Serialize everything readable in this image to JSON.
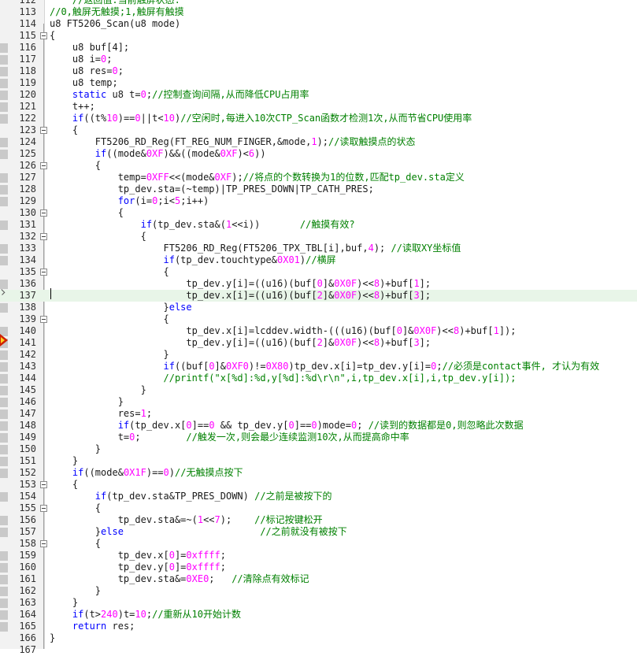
{
  "colors": {
    "keyword": "#0000ff",
    "number": "#ff00ff",
    "comment": "#008000",
    "text": "#1a1a1a",
    "current_line": "#e8f5e8",
    "breakpoint": "#d02000"
  },
  "editor": {
    "current_line": 137,
    "execution_marker_line": 141,
    "lines": [
      {
        "n": "112",
        "fold": false,
        "tokens": [
          {
            "t": "    "
          },
          {
            "t": "//返回值:当前触屏状态.",
            "c": "cm"
          }
        ]
      },
      {
        "n": "113",
        "fold": false,
        "tokens": [
          {
            "t": "//0,触屏无触摸;1,触屏有触摸",
            "c": "cm"
          }
        ]
      },
      {
        "n": "114",
        "fold": false,
        "tokens": [
          {
            "t": "u8 FT5206_Scan(u8 mode)"
          }
        ]
      },
      {
        "n": "115",
        "fold": true,
        "tokens": [
          {
            "t": "{"
          }
        ]
      },
      {
        "n": "116",
        "fold": false,
        "tokens": [
          {
            "t": "    u8 buf[4];"
          }
        ]
      },
      {
        "n": "117",
        "fold": false,
        "tokens": [
          {
            "t": "    u8 i="
          },
          {
            "t": "0",
            "c": "num"
          },
          {
            "t": ";"
          }
        ]
      },
      {
        "n": "118",
        "fold": false,
        "tokens": [
          {
            "t": "    u8 res="
          },
          {
            "t": "0",
            "c": "num"
          },
          {
            "t": ";"
          }
        ]
      },
      {
        "n": "119",
        "fold": false,
        "tokens": [
          {
            "t": "    u8 temp;"
          }
        ]
      },
      {
        "n": "120",
        "fold": false,
        "tokens": [
          {
            "t": "    "
          },
          {
            "t": "static",
            "c": "kw"
          },
          {
            "t": " u8 t="
          },
          {
            "t": "0",
            "c": "num"
          },
          {
            "t": ";"
          },
          {
            "t": "//控制查询间隔,从而降低CPU占用率",
            "c": "cm"
          }
        ]
      },
      {
        "n": "121",
        "fold": false,
        "tokens": [
          {
            "t": "    t++;"
          }
        ]
      },
      {
        "n": "122",
        "fold": false,
        "tokens": [
          {
            "t": "    "
          },
          {
            "t": "if",
            "c": "kw"
          },
          {
            "t": "((t%"
          },
          {
            "t": "10",
            "c": "num"
          },
          {
            "t": ")=="
          },
          {
            "t": "0",
            "c": "num"
          },
          {
            "t": "||t<"
          },
          {
            "t": "10",
            "c": "num"
          },
          {
            "t": ")"
          },
          {
            "t": "//空闲时,每进入10次CTP_Scan函数才检测1次,从而节省CPU使用率",
            "c": "cm"
          }
        ]
      },
      {
        "n": "123",
        "fold": true,
        "tokens": [
          {
            "t": "    {"
          }
        ]
      },
      {
        "n": "124",
        "fold": false,
        "tokens": [
          {
            "t": "        FT5206_RD_Reg(FT_REG_NUM_FINGER,&mode,"
          },
          {
            "t": "1",
            "c": "num"
          },
          {
            "t": ");"
          },
          {
            "t": "//读取触摸点的状态",
            "c": "cm"
          }
        ]
      },
      {
        "n": "125",
        "fold": false,
        "tokens": [
          {
            "t": "        "
          },
          {
            "t": "if",
            "c": "kw"
          },
          {
            "t": "((mode&"
          },
          {
            "t": "0XF",
            "c": "num"
          },
          {
            "t": ")&&((mode&"
          },
          {
            "t": "0XF",
            "c": "num"
          },
          {
            "t": ")<"
          },
          {
            "t": "6",
            "c": "num"
          },
          {
            "t": "))"
          }
        ]
      },
      {
        "n": "126",
        "fold": true,
        "tokens": [
          {
            "t": "        {"
          }
        ]
      },
      {
        "n": "127",
        "fold": false,
        "tokens": [
          {
            "t": "            temp="
          },
          {
            "t": "0XFF",
            "c": "num"
          },
          {
            "t": "<<(mode&"
          },
          {
            "t": "0XF",
            "c": "num"
          },
          {
            "t": ");"
          },
          {
            "t": "//将点的个数转换为1的位数,匹配tp_dev.sta定义",
            "c": "cm"
          }
        ]
      },
      {
        "n": "128",
        "fold": false,
        "tokens": [
          {
            "t": "            tp_dev.sta=(~temp)|TP_PRES_DOWN|TP_CATH_PRES;"
          }
        ]
      },
      {
        "n": "129",
        "fold": false,
        "tokens": [
          {
            "t": "            "
          },
          {
            "t": "for",
            "c": "kw"
          },
          {
            "t": "(i="
          },
          {
            "t": "0",
            "c": "num"
          },
          {
            "t": ";i<"
          },
          {
            "t": "5",
            "c": "num"
          },
          {
            "t": ";i++)"
          }
        ]
      },
      {
        "n": "130",
        "fold": true,
        "tokens": [
          {
            "t": "            {"
          }
        ]
      },
      {
        "n": "131",
        "fold": false,
        "tokens": [
          {
            "t": "                "
          },
          {
            "t": "if",
            "c": "kw"
          },
          {
            "t": "(tp_dev.sta&("
          },
          {
            "t": "1",
            "c": "num"
          },
          {
            "t": "<<i))       "
          },
          {
            "t": "//触摸有效?",
            "c": "cm"
          }
        ]
      },
      {
        "n": "132",
        "fold": true,
        "tokens": [
          {
            "t": "                {"
          }
        ]
      },
      {
        "n": "133",
        "fold": false,
        "tokens": [
          {
            "t": "                    FT5206_RD_Reg(FT5206_TPX_TBL[i],buf,"
          },
          {
            "t": "4",
            "c": "num"
          },
          {
            "t": "); "
          },
          {
            "t": "//读取XY坐标值",
            "c": "cm"
          }
        ]
      },
      {
        "n": "134",
        "fold": false,
        "tokens": [
          {
            "t": "                    "
          },
          {
            "t": "if",
            "c": "kw"
          },
          {
            "t": "(tp_dev.touchtype&"
          },
          {
            "t": "0X01",
            "c": "num"
          },
          {
            "t": ")"
          },
          {
            "t": "//横屏",
            "c": "cm"
          }
        ]
      },
      {
        "n": "135",
        "fold": true,
        "tokens": [
          {
            "t": "                    {"
          }
        ]
      },
      {
        "n": "136",
        "fold": false,
        "tokens": [
          {
            "t": "                        tp_dev.y[i]=((u16)(buf["
          },
          {
            "t": "0",
            "c": "num"
          },
          {
            "t": "]&"
          },
          {
            "t": "0X0F",
            "c": "num"
          },
          {
            "t": ")<<"
          },
          {
            "t": "8",
            "c": "num"
          },
          {
            "t": ")+buf["
          },
          {
            "t": "1",
            "c": "num"
          },
          {
            "t": "];"
          }
        ]
      },
      {
        "n": "137",
        "fold": false,
        "tokens": [
          {
            "t": "                        tp_dev.x[i]=((u16)(buf["
          },
          {
            "t": "2",
            "c": "num"
          },
          {
            "t": "]&"
          },
          {
            "t": "0X0F",
            "c": "num"
          },
          {
            "t": ")<<"
          },
          {
            "t": "8",
            "c": "num"
          },
          {
            "t": ")+buf["
          },
          {
            "t": "3",
            "c": "num"
          },
          {
            "t": "];"
          }
        ]
      },
      {
        "n": "138",
        "fold": false,
        "tokens": [
          {
            "t": "                    }"
          },
          {
            "t": "else",
            "c": "kw"
          }
        ]
      },
      {
        "n": "139",
        "fold": true,
        "tokens": [
          {
            "t": "                    {"
          }
        ]
      },
      {
        "n": "140",
        "fold": false,
        "tokens": [
          {
            "t": "                        tp_dev.x[i]=lcddev.width-(((u16)(buf["
          },
          {
            "t": "0",
            "c": "num"
          },
          {
            "t": "]&"
          },
          {
            "t": "0X0F",
            "c": "num"
          },
          {
            "t": ")<<"
          },
          {
            "t": "8",
            "c": "num"
          },
          {
            "t": ")+buf["
          },
          {
            "t": "1",
            "c": "num"
          },
          {
            "t": "]);"
          }
        ]
      },
      {
        "n": "141",
        "fold": false,
        "tokens": [
          {
            "t": "                        tp_dev.y[i]=((u16)(buf["
          },
          {
            "t": "2",
            "c": "num"
          },
          {
            "t": "]&"
          },
          {
            "t": "0X0F",
            "c": "num"
          },
          {
            "t": ")<<"
          },
          {
            "t": "8",
            "c": "num"
          },
          {
            "t": ")+buf["
          },
          {
            "t": "3",
            "c": "num"
          },
          {
            "t": "];"
          }
        ]
      },
      {
        "n": "142",
        "fold": false,
        "tokens": [
          {
            "t": "                    }"
          }
        ]
      },
      {
        "n": "143",
        "fold": false,
        "tokens": [
          {
            "t": "                    "
          },
          {
            "t": "if",
            "c": "kw"
          },
          {
            "t": "((buf["
          },
          {
            "t": "0",
            "c": "num"
          },
          {
            "t": "]&"
          },
          {
            "t": "0XF0",
            "c": "num"
          },
          {
            "t": ")!="
          },
          {
            "t": "0X80",
            "c": "num"
          },
          {
            "t": ")tp_dev.x[i]=tp_dev.y[i]="
          },
          {
            "t": "0",
            "c": "num"
          },
          {
            "t": ";"
          },
          {
            "t": "//必须是contact事件, 才认为有效",
            "c": "cm"
          }
        ]
      },
      {
        "n": "144",
        "fold": false,
        "tokens": [
          {
            "t": "                    "
          },
          {
            "t": "//printf(\"x[%d]:%d,y[%d]:%d\\r\\n\",i,tp_dev.x[i],i,tp_dev.y[i]);",
            "c": "cm"
          }
        ]
      },
      {
        "n": "145",
        "fold": false,
        "tokens": [
          {
            "t": "                }"
          }
        ]
      },
      {
        "n": "146",
        "fold": false,
        "tokens": [
          {
            "t": "            }"
          }
        ]
      },
      {
        "n": "147",
        "fold": false,
        "tokens": [
          {
            "t": "            res="
          },
          {
            "t": "1",
            "c": "num"
          },
          {
            "t": ";"
          }
        ]
      },
      {
        "n": "148",
        "fold": false,
        "tokens": [
          {
            "t": "            "
          },
          {
            "t": "if",
            "c": "kw"
          },
          {
            "t": "(tp_dev.x["
          },
          {
            "t": "0",
            "c": "num"
          },
          {
            "t": "]=="
          },
          {
            "t": "0",
            "c": "num"
          },
          {
            "t": " && tp_dev.y["
          },
          {
            "t": "0",
            "c": "num"
          },
          {
            "t": "]=="
          },
          {
            "t": "0",
            "c": "num"
          },
          {
            "t": ")mode="
          },
          {
            "t": "0",
            "c": "num"
          },
          {
            "t": "; "
          },
          {
            "t": "//读到的数据都是0,则忽略此次数据",
            "c": "cm"
          }
        ]
      },
      {
        "n": "149",
        "fold": false,
        "tokens": [
          {
            "t": "            t="
          },
          {
            "t": "0",
            "c": "num"
          },
          {
            "t": ";        "
          },
          {
            "t": "//触发一次,则会最少连续监测10次,从而提高命中率",
            "c": "cm"
          }
        ]
      },
      {
        "n": "150",
        "fold": false,
        "tokens": [
          {
            "t": "        }"
          }
        ]
      },
      {
        "n": "151",
        "fold": false,
        "tokens": [
          {
            "t": "    }"
          }
        ]
      },
      {
        "n": "152",
        "fold": false,
        "tokens": [
          {
            "t": "    "
          },
          {
            "t": "if",
            "c": "kw"
          },
          {
            "t": "((mode&"
          },
          {
            "t": "0X1F",
            "c": "num"
          },
          {
            "t": ")=="
          },
          {
            "t": "0",
            "c": "num"
          },
          {
            "t": ")"
          },
          {
            "t": "//无触摸点按下",
            "c": "cm"
          }
        ]
      },
      {
        "n": "153",
        "fold": true,
        "tokens": [
          {
            "t": "    {"
          }
        ]
      },
      {
        "n": "154",
        "fold": false,
        "tokens": [
          {
            "t": "        "
          },
          {
            "t": "if",
            "c": "kw"
          },
          {
            "t": "(tp_dev.sta&TP_PRES_DOWN) "
          },
          {
            "t": "//之前是被按下的",
            "c": "cm"
          }
        ]
      },
      {
        "n": "155",
        "fold": true,
        "tokens": [
          {
            "t": "        {"
          }
        ]
      },
      {
        "n": "156",
        "fold": false,
        "tokens": [
          {
            "t": "            tp_dev.sta&=~("
          },
          {
            "t": "1",
            "c": "num"
          },
          {
            "t": "<<"
          },
          {
            "t": "7",
            "c": "num"
          },
          {
            "t": ");    "
          },
          {
            "t": "//标记按键松开",
            "c": "cm"
          }
        ]
      },
      {
        "n": "157",
        "fold": false,
        "tokens": [
          {
            "t": "        }"
          },
          {
            "t": "else",
            "c": "kw"
          },
          {
            "t": "                        "
          },
          {
            "t": "//之前就没有被按下",
            "c": "cm"
          }
        ]
      },
      {
        "n": "158",
        "fold": true,
        "tokens": [
          {
            "t": "        {"
          }
        ]
      },
      {
        "n": "159",
        "fold": false,
        "tokens": [
          {
            "t": "            tp_dev.x["
          },
          {
            "t": "0",
            "c": "num"
          },
          {
            "t": "]="
          },
          {
            "t": "0xffff",
            "c": "num"
          },
          {
            "t": ";"
          }
        ]
      },
      {
        "n": "160",
        "fold": false,
        "tokens": [
          {
            "t": "            tp_dev.y["
          },
          {
            "t": "0",
            "c": "num"
          },
          {
            "t": "]="
          },
          {
            "t": "0xffff",
            "c": "num"
          },
          {
            "t": ";"
          }
        ]
      },
      {
        "n": "161",
        "fold": false,
        "tokens": [
          {
            "t": "            tp_dev.sta&="
          },
          {
            "t": "0XE0",
            "c": "num"
          },
          {
            "t": ";   "
          },
          {
            "t": "//清除点有效标记",
            "c": "cm"
          }
        ]
      },
      {
        "n": "162",
        "fold": false,
        "tokens": [
          {
            "t": "        }"
          }
        ]
      },
      {
        "n": "163",
        "fold": false,
        "tokens": [
          {
            "t": "    }"
          }
        ]
      },
      {
        "n": "164",
        "fold": false,
        "tokens": [
          {
            "t": "    "
          },
          {
            "t": "if",
            "c": "kw"
          },
          {
            "t": "(t>"
          },
          {
            "t": "240",
            "c": "num"
          },
          {
            "t": ")t="
          },
          {
            "t": "10",
            "c": "num"
          },
          {
            "t": ";"
          },
          {
            "t": "//重新从10开始计数",
            "c": "cm"
          }
        ]
      },
      {
        "n": "165",
        "fold": false,
        "tokens": [
          {
            "t": "    "
          },
          {
            "t": "return",
            "c": "kw"
          },
          {
            "t": " res;"
          }
        ]
      },
      {
        "n": "166",
        "fold": false,
        "tokens": [
          {
            "t": "}"
          }
        ]
      },
      {
        "n": "167",
        "fold": false,
        "tokens": [
          {
            "t": ""
          }
        ]
      }
    ]
  }
}
